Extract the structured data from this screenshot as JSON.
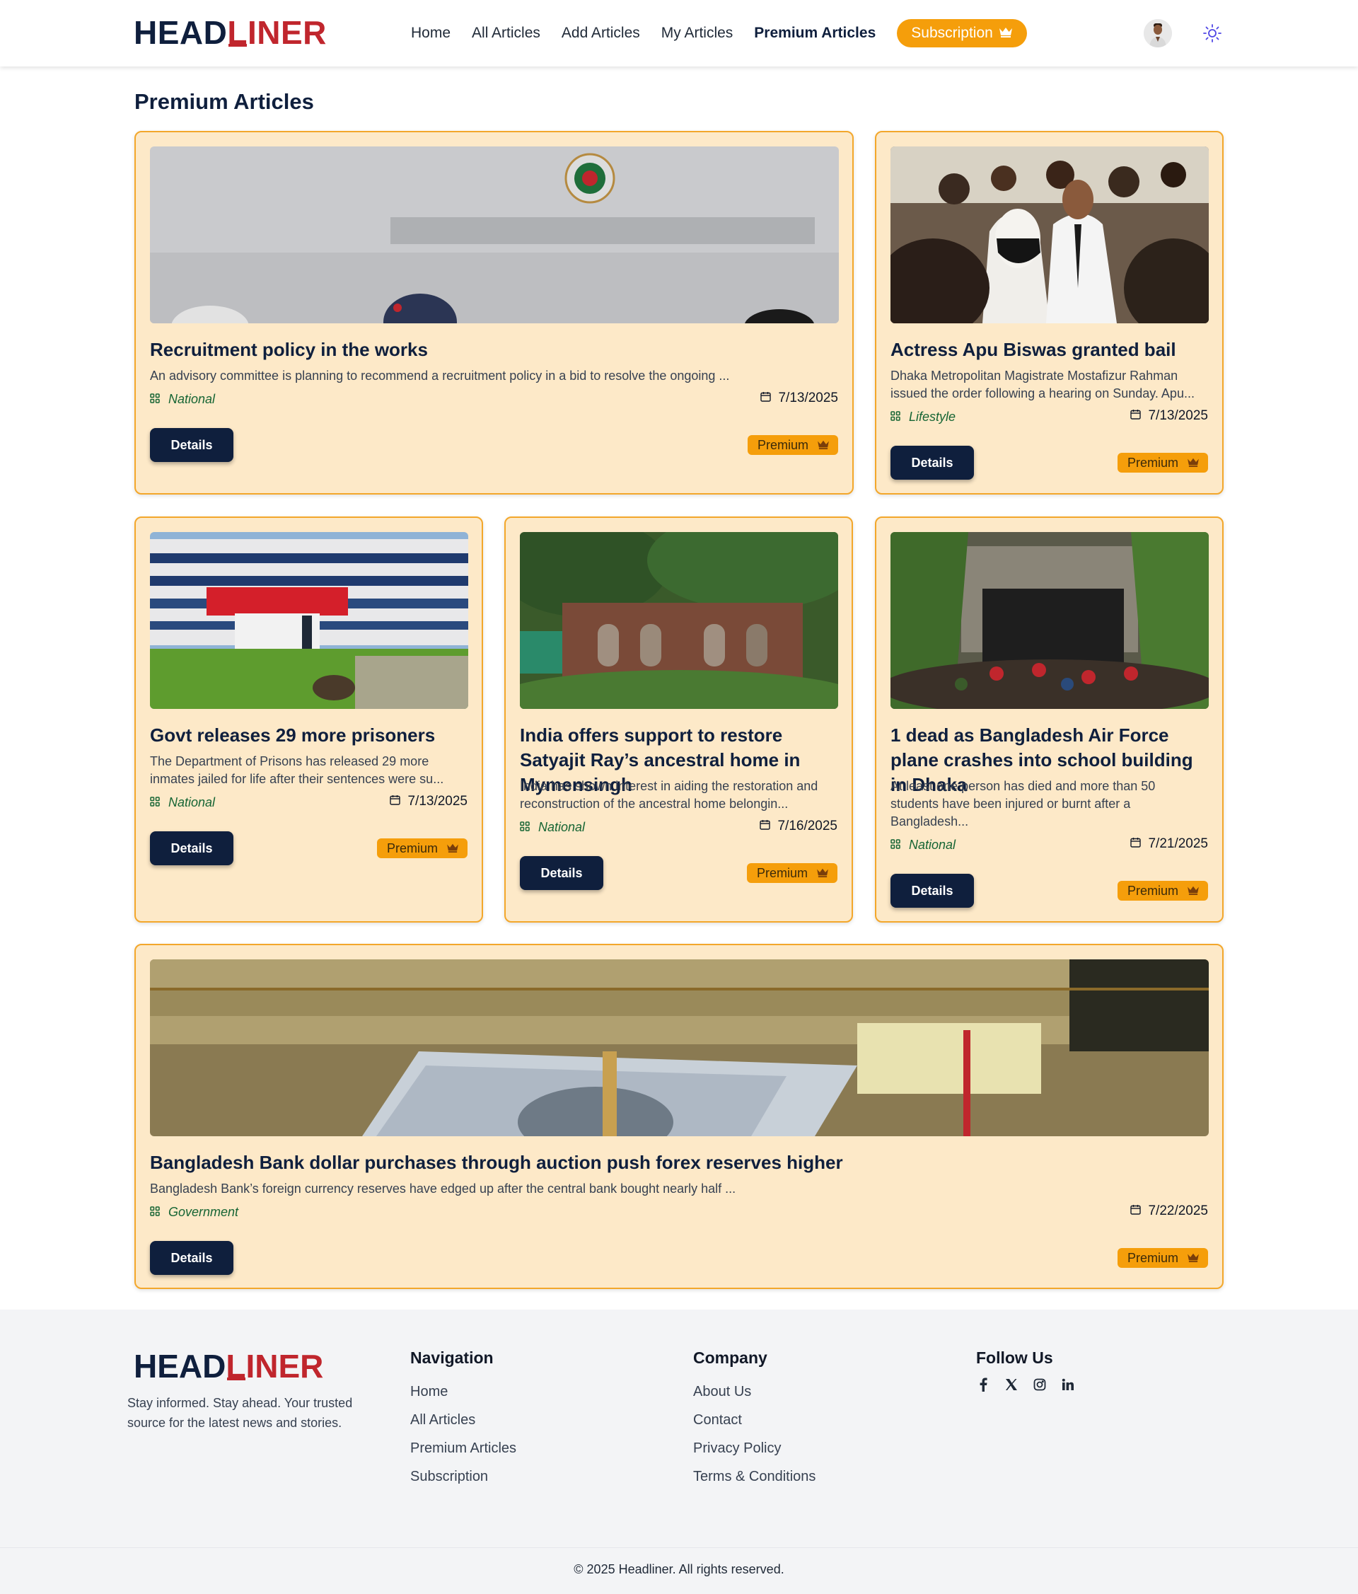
{
  "brand": {
    "head": "HEAD",
    "liner": "LINER",
    "accent": "#c0262d",
    "navy": "#0f1f3d",
    "orange": "#f59e0b"
  },
  "nav": {
    "items": [
      "Home",
      "All Articles",
      "Add Articles",
      "My Articles",
      "Premium Articles"
    ],
    "active": "Premium Articles",
    "subscription_label": "Subscription"
  },
  "page": {
    "title": "Premium Articles"
  },
  "labels": {
    "details": "Details",
    "premium": "Premium"
  },
  "articles": [
    {
      "title": "Recruitment policy in the works",
      "desc": "An advisory committee is planning to recommend a recruitment policy in a bid to resolve the ongoing ...",
      "category": "National",
      "date": "7/13/2025",
      "image": "ministry-signboard"
    },
    {
      "title": "Actress Apu Biswas granted bail",
      "desc": "Dhaka Metropolitan Magistrate Mostafizur Rahman issued the order following a hearing on Sunday. Apu...",
      "category": "Lifestyle",
      "date": "7/13/2025",
      "image": "crowd-photo"
    },
    {
      "title": "Govt releases 29 more prisoners",
      "desc": "The Department of Prisons has released 29 more inmates jailed for life after their sentences were su...",
      "category": "National",
      "date": "7/13/2025",
      "image": "prison-building"
    },
    {
      "title": "India offers support to restore Satyajit Ray’s ancestral home in Mymensingh",
      "desc": "India has shown interest in aiding the restoration and reconstruction of the ancestral home belongin...",
      "category": "National",
      "date": "7/16/2025",
      "image": "old-house-ruins"
    },
    {
      "title": "1 dead as Bangladesh Air Force plane crashes into school building in Dhaka",
      "desc": "At least one person has died and more than 50 students have been injured or burnt after a Bangladesh...",
      "category": "National",
      "date": "7/21/2025",
      "image": "crash-site"
    },
    {
      "title": "Bangladesh Bank dollar purchases through auction push forex reserves higher",
      "desc": "Bangladesh Bank’s foreign currency reserves have edged up after the central bank bought nearly half ...",
      "category": "Government",
      "date": "7/22/2025",
      "image": "dollar-bills"
    }
  ],
  "footer": {
    "tagline": "Stay informed. Stay ahead. Your trusted source for the latest news and stories.",
    "navigation": {
      "heading": "Navigation",
      "links": [
        "Home",
        "All Articles",
        "Premium Articles",
        "Subscription"
      ]
    },
    "company": {
      "heading": "Company",
      "links": [
        "About Us",
        "Contact",
        "Privacy Policy",
        "Terms & Conditions"
      ]
    },
    "follow": {
      "heading": "Follow Us",
      "icons": [
        "facebook-icon",
        "x-icon",
        "instagram-icon",
        "linkedin-icon"
      ]
    },
    "copyright": "© 2025 Headliner. All rights reserved."
  }
}
